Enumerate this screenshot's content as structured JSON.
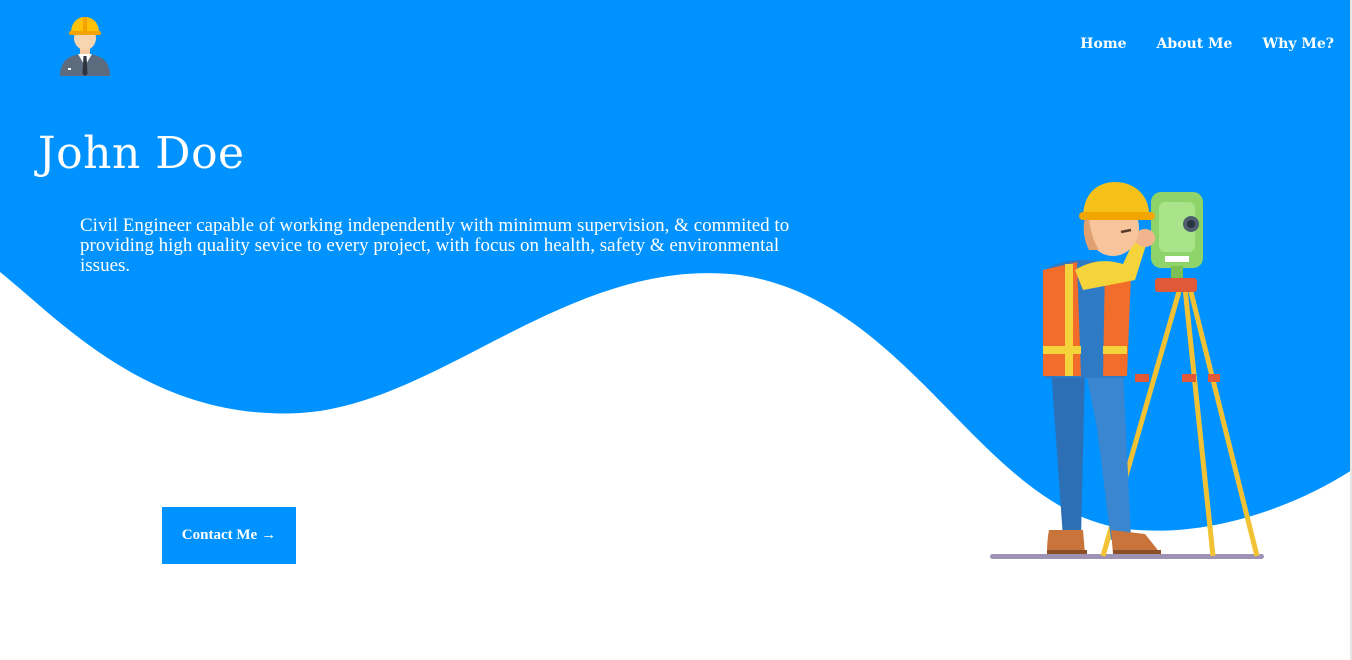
{
  "colors": {
    "primary": "#0092ff",
    "background": "#ffffff",
    "text_on_primary": "#ffffff"
  },
  "header": {
    "logo_icon": "engineer-avatar-icon",
    "nav": [
      {
        "label": "Home"
      },
      {
        "label": "About Me"
      },
      {
        "label": "Why Me?"
      }
    ]
  },
  "hero": {
    "name": "John Doe",
    "tagline": "Civil Engineer capable of working independently with minimum supervision, & commited to providing high quality sevice to every project, with focus on health, safety & environmental issues.",
    "cta_label": "Contact Me",
    "cta_arrow": "→",
    "illustration": "surveyor-with-theodolite-illustration"
  }
}
